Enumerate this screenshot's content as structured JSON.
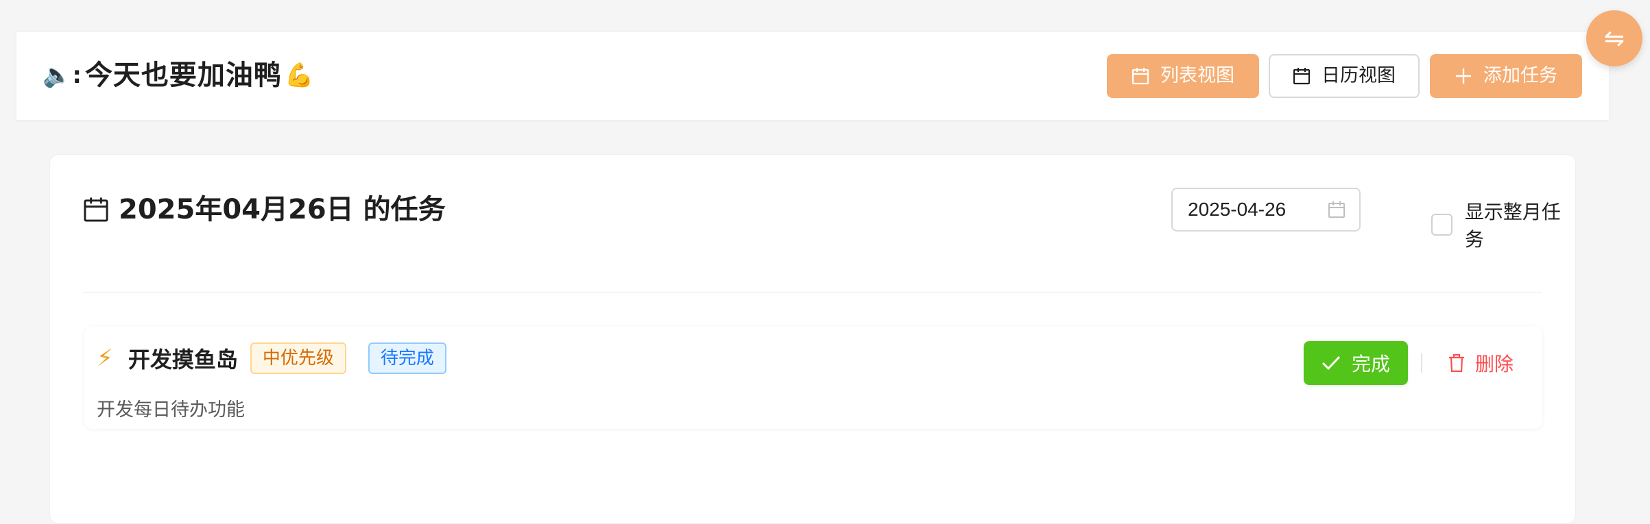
{
  "header": {
    "title_prefix": "🔈:",
    "title_text": "今天也要加油鸭",
    "title_suffix": "💪",
    "buttons": {
      "list_view": "列表视图",
      "calendar_view": "日历视图",
      "add_task": "添加任务"
    }
  },
  "fab": {
    "icon": "swap-icon",
    "glyph": "⇋"
  },
  "main": {
    "heading": "2025年04月26日 的任务",
    "date_value": "2025-04-26",
    "show_month_label": "显示整月任务",
    "show_month_checked": false
  },
  "tasks": [
    {
      "icon": "lightning-icon",
      "name": "开发摸鱼岛",
      "priority": "中优先级",
      "status": "待完成",
      "description": "开发每日待办功能",
      "complete_label": "完成",
      "delete_label": "删除"
    }
  ],
  "colors": {
    "accent": "#f5ad73",
    "complete": "#52c41a",
    "danger": "#ff4d4f",
    "priority": "#d46b08",
    "status": "#1677ff"
  }
}
